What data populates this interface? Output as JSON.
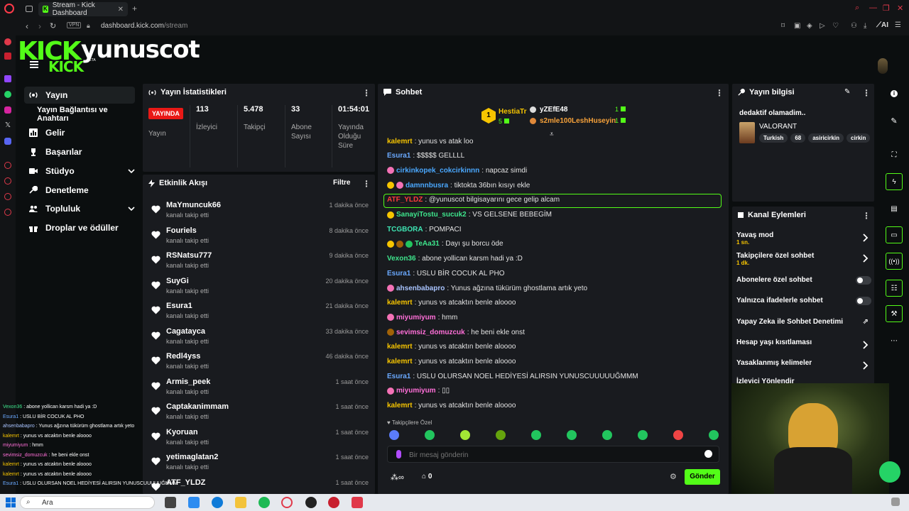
{
  "browser": {
    "tab_title": "Stream - Kick Dashboard",
    "new_tab": "+",
    "vpn": "VPN",
    "url_host": "dashboard.kick.com",
    "url_path": "/stream",
    "ai_label": "AI"
  },
  "header": {
    "logo_text": "KICK",
    "logo_sub": "KICK",
    "beta": "BETA",
    "channel_name": "yunuscot"
  },
  "sidebar": {
    "items": [
      {
        "label": "Yayın",
        "icon": "broadcast-icon"
      },
      {
        "label": "Yayın Bağlantısı ve Anahtarı",
        "icon": "none"
      },
      {
        "label": "Gelir",
        "icon": "chart-icon"
      },
      {
        "label": "Başarılar",
        "icon": "trophy-icon"
      },
      {
        "label": "Stüdyo",
        "icon": "camera-icon"
      },
      {
        "label": "Denetleme",
        "icon": "wrench-icon"
      },
      {
        "label": "Topluluk",
        "icon": "people-icon"
      },
      {
        "label": "Droplar ve ödüller",
        "icon": "gift-icon"
      }
    ]
  },
  "stats": {
    "title": "Yayın İstatistikleri",
    "live_badge": "YAYINDA",
    "live_label": "Yayın",
    "viewers_value": "113",
    "viewers_label": "İzleyici",
    "followers_value": "5.478",
    "followers_label": "Takipçi",
    "subs_value": "33",
    "subs_label1": "Abone",
    "subs_label2": "Sayısı",
    "uptime_value": "01:54:01",
    "uptime_label1": "Yayında",
    "uptime_label2": "Olduğu",
    "uptime_label3": "Süre"
  },
  "activity": {
    "title": "Etkinlik Akışı",
    "filter": "Filtre",
    "items": [
      {
        "name": "MaYmuncuk66",
        "action": "kanalı takip etti",
        "time": "1 dakika önce"
      },
      {
        "name": "Fouriels",
        "action": "kanalı takip etti",
        "time": "8 dakika önce"
      },
      {
        "name": "RSNatsu777",
        "action": "kanalı takip etti",
        "time": "9 dakika önce"
      },
      {
        "name": "SuyGi",
        "action": "kanalı takip etti",
        "time": "20 dakika önce"
      },
      {
        "name": "Esura1",
        "action": "kanalı takip etti",
        "time": "21 dakika önce"
      },
      {
        "name": "Cagatayca",
        "action": "kanalı takip etti",
        "time": "33 dakika önce"
      },
      {
        "name": "Redl4yss",
        "action": "kanalı takip etti",
        "time": "46 dakika önce"
      },
      {
        "name": "Armis_peek",
        "action": "kanalı takip etti",
        "time": "1 saat önce"
      },
      {
        "name": "Captakanimmam",
        "action": "kanalı takip etti",
        "time": "1 saat önce"
      },
      {
        "name": "Kyoruan",
        "action": "kanalı takip etti",
        "time": "1 saat önce"
      },
      {
        "name": "yetimaglatan2",
        "action": "kanalı takip etti",
        "time": "1 saat önce"
      },
      {
        "name": "ATF_YLDZ",
        "action": "",
        "time": "1 saat önce"
      }
    ]
  },
  "chat": {
    "title": "Sohbet",
    "leaders": {
      "first_rank": "1",
      "first_name": "HestiaTr",
      "first_count": "5",
      "second_name": "yZEfE48",
      "second_count": "1",
      "third_name": "s2mle100LeshHuseyin",
      "third_count": "1"
    },
    "messages": [
      {
        "user": "kalemrt",
        "color": "#f7c500",
        "text": ": yunus vs atak loo",
        "badges": []
      },
      {
        "user": "Esura1",
        "color": "#6aa9ff",
        "text": ": $$$$$ GELLLL",
        "badges": []
      },
      {
        "user": "cirkinkopek_cokcirkinnn",
        "color": "#4aa8ff",
        "text": ": napcaz simdi",
        "badges": [
          "#f472b6"
        ]
      },
      {
        "user": "damnnbusra",
        "color": "#4aa8ff",
        "text": ": tiktokta 36bın kısıyı ekle",
        "badges": [
          "#f7c500",
          "#f472b6"
        ]
      },
      {
        "user": "ATF_YLDZ",
        "color": "#ff3b3b",
        "text": ": @yunuscot bilgisayarını gece gelip alcam",
        "badges": []
      },
      {
        "user": "SanayiTostu_sucuk2",
        "color": "#3ee58c",
        "text": ": VS GELSENE BEBEGİM",
        "badges": [
          "#f7c500"
        ]
      },
      {
        "user": "TCGBORA",
        "color": "#3ee5b3",
        "text": ": POMPACI",
        "badges": []
      },
      {
        "user": "TeAa31",
        "color": "#3ee58c",
        "text": ": Dayı şu borcu öde",
        "badges": [
          "#f7c500",
          "#a16207",
          "#22c55e"
        ]
      },
      {
        "user": "Vexon36",
        "color": "#3ee58c",
        "text": ": abone yollican karsm hadi ya :D",
        "badges": []
      },
      {
        "user": "Esura1",
        "color": "#6aa9ff",
        "text": ": USLU BİR COCUK AL PHO",
        "badges": []
      },
      {
        "user": "ahsenbabapro",
        "color": "#a9c4ff",
        "text": ": Yunus ağzına tükürüm ghostlama artık yeto",
        "badges": [
          "#f472b6"
        ]
      },
      {
        "user": "kalemrt",
        "color": "#f7c500",
        "text": ": yunus vs atcaktın benle aloooo",
        "badges": []
      },
      {
        "user": "miyumiyum",
        "color": "#ff6fd8",
        "text": ": hmm",
        "badges": [
          "#f472b6"
        ]
      },
      {
        "user": "sevimsiz_domuzcuk",
        "color": "#ff6fd8",
        "text": ": he beni ekle onst",
        "badges": [
          "#a16207"
        ]
      },
      {
        "user": "kalemrt",
        "color": "#f7c500",
        "text": ": yunus vs atcaktın benle aloooo",
        "badges": []
      },
      {
        "user": "kalemrt",
        "color": "#f7c500",
        "text": ": yunus vs atcaktın benle aloooo",
        "badges": []
      },
      {
        "user": "Esura1",
        "color": "#6aa9ff",
        "text": ": USLU OLURSAN NOEL HEDİYESİ ALIRSIN YUNUSCUUUUUĞMMM",
        "badges": []
      },
      {
        "user": "miyumiyum",
        "color": "#ff6fd8",
        "text": ": ▯▯",
        "badges": [
          "#f472b6"
        ]
      },
      {
        "user": "kalemrt",
        "color": "#f7c500",
        "text": ": yunus vs atcaktın benle aloooo",
        "badges": []
      }
    ],
    "followers_only": "♥ Takipçilere Özel",
    "input_placeholder": "Bir mesaj gönderin",
    "points": "0",
    "send": "Gönder"
  },
  "stream_info": {
    "title": "Yayın bilgisi",
    "stream_title": "dedaktif olamadim..",
    "category": "VALORANT",
    "tags": [
      "Turkish",
      "68",
      "asiricirkin",
      "cirkin"
    ]
  },
  "channel_actions": {
    "title": "Kanal Eylemleri",
    "items": [
      {
        "label": "Yavaş mod",
        "sub": "1 sn.",
        "control": "chevron"
      },
      {
        "label": "Takipçilere özel sohbet",
        "sub": "1 dk.",
        "control": "chevron"
      },
      {
        "label": "Abonelere özel sohbet",
        "sub": "",
        "control": "toggle"
      },
      {
        "label": "Yalnızca ifadelerle sohbet",
        "sub": "",
        "control": "toggle"
      },
      {
        "label": "Yapay Zeka ile Sohbet Denetimi",
        "sub": "",
        "control": "external"
      },
      {
        "label": "Hesap yaşı kısıtlaması",
        "sub": "",
        "control": "chevron"
      },
      {
        "label": "Yasaklanmış kelimeler",
        "sub": "",
        "control": "chevron"
      },
      {
        "label": "İzleyici Yönlendir",
        "sub": "",
        "control": "none"
      }
    ]
  },
  "overlay_chat": [
    {
      "user": "Vexon36",
      "color": "#3ee58c",
      "text": " : abone yollican karsm hadi ya :D"
    },
    {
      "user": "Esura1",
      "color": "#6aa9ff",
      "text": " : USLU BİR COCUK AL PHO"
    },
    {
      "user": "ahsenbabapro",
      "color": "#a9c4ff",
      "text": " : Yunus ağzına tükürüm ghostlama artık yeto"
    },
    {
      "user": "kalemrt",
      "color": "#f7c500",
      "text": " : yunus vs atcaktın benle aloooo"
    },
    {
      "user": "miyumiyum",
      "color": "#ff6fd8",
      "text": " : hmm"
    },
    {
      "user": "sevimsiz_domuzcuk",
      "color": "#ff6fd8",
      "text": " : he beni ekle onst"
    },
    {
      "user": "kalemrt",
      "color": "#f7c500",
      "text": " : yunus vs atcaktın benle aloooo"
    },
    {
      "user": "kalemrt",
      "color": "#f7c500",
      "text": " : yunus vs atcaktın benle aloooo"
    },
    {
      "user": "Esura1",
      "color": "#6aa9ff",
      "text": " : USLU OLURSAN NOEL HEDİYESİ ALIRSIN YUNUSCUUUUUĞMMM"
    }
  ],
  "taskbar": {
    "search": "Ara"
  },
  "colors": {
    "accent": "#53fc18",
    "live": "#e91916",
    "panel": "#191b1f",
    "background": "#0b0e0f"
  }
}
